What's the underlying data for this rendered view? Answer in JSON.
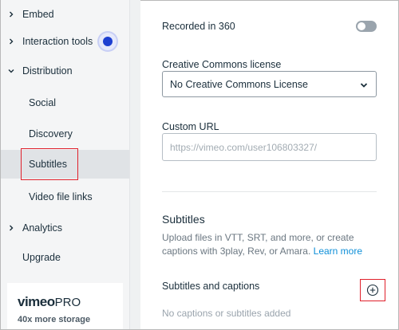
{
  "sidebar": {
    "items": [
      {
        "label": "Embed",
        "chevron": "right"
      },
      {
        "label": "Interaction tools",
        "chevron": "right"
      },
      {
        "label": "Distribution",
        "chevron": "down"
      },
      {
        "label": "Social"
      },
      {
        "label": "Discovery"
      },
      {
        "label": "Subtitles"
      },
      {
        "label": "Video file links"
      },
      {
        "label": "Analytics",
        "chevron": "right"
      },
      {
        "label": "Upgrade"
      }
    ],
    "promo": {
      "logo_text": "vimeo",
      "logo_suffix": "PRO",
      "storage_text": "40x more storage"
    }
  },
  "main": {
    "recorded_360": {
      "label": "Recorded in 360",
      "enabled": false
    },
    "license": {
      "label": "Creative Commons license",
      "selected": "No Creative Commons License"
    },
    "custom_url": {
      "label": "Custom URL",
      "placeholder": "https://vimeo.com/user106803327/"
    },
    "subtitles": {
      "title": "Subtitles",
      "description": "Upload files in VTT, SRT, and more, or create captions with 3play, Rev, or Amara.",
      "link_text": "Learn more",
      "captions_label": "Subtitles and captions",
      "empty_text": "No captions or subtitles added"
    }
  },
  "colors": {
    "accent_blue": "#1d3fd1",
    "link": "#0e8fd8",
    "highlight_red": "#e0202b",
    "sidebar_bg": "#f4f5f6",
    "active_bg": "#e0e3e6"
  }
}
